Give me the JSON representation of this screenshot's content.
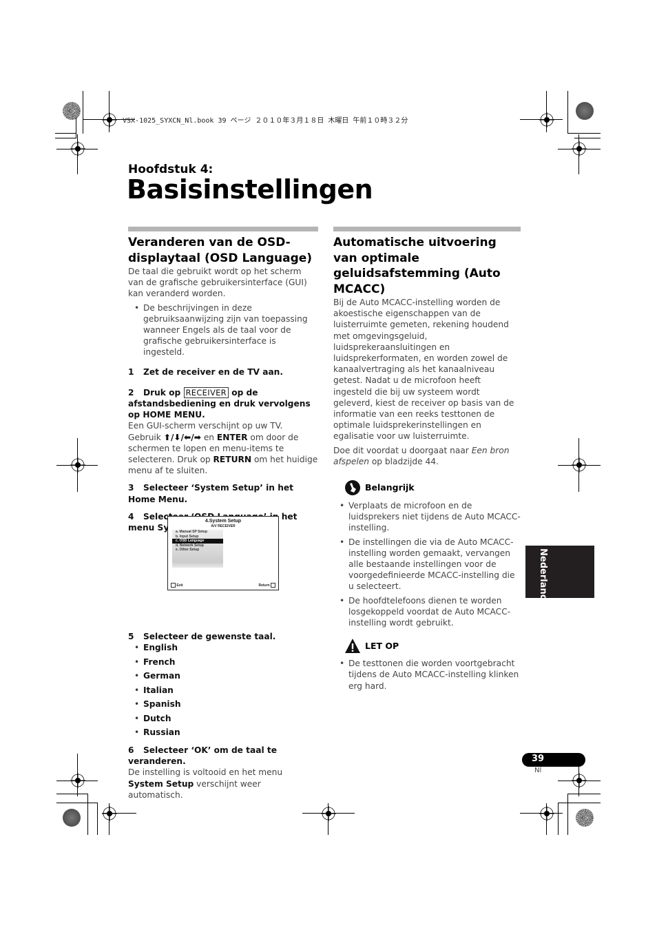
{
  "print_header": "VSX-1025_SYXCN_Nl.book  39 ページ  ２０１０年３月１８日  木曜日  午前１０時３２分",
  "chapter": {
    "label": "Hoofdstuk 4:",
    "title": "Basisinstellingen"
  },
  "left": {
    "heading": "Veranderen van de OSD-displaytaal (OSD Language)",
    "intro": "De taal die gebruikt wordt op het scherm van de grafische gebruikersinterface (GUI) kan veranderd worden.",
    "bullets": [
      "De beschrijvingen in deze gebruiksaanwijzing zijn van toepassing wanneer Engels als de taal voor de grafische gebruikersinterface is ingesteld."
    ],
    "steps": {
      "s1": {
        "num": "1",
        "text": "Zet de receiver en de TV aan."
      },
      "s2": {
        "num": "2",
        "pre": "Druk op",
        "key": "RECEIVER",
        "post": "op de afstandsbediening en druk vervolgens op HOME MENU.",
        "body_1": "Een GUI-scherm verschijnt op uw TV. Gebruik",
        "arrows": "⬆/⬇/⬅/➡",
        "body_2": "en",
        "enter": "ENTER",
        "body_3": "om door de schermen te lopen en menu-items te selecteren. Druk op",
        "return": "RETURN",
        "body_4": "om het huidige menu af te sluiten."
      },
      "s3": {
        "num": "3",
        "text": "Selecteer ‘System Setup’ in het Home Menu."
      },
      "s4": {
        "num": "4",
        "text": "Selecteer ‘OSD Language’ in het menu System Setup."
      },
      "s5": {
        "num": "5",
        "text": "Selecteer de gewenste taal."
      },
      "s6": {
        "num": "6",
        "text": "Selecteer ‘OK’ om de taal te veranderen.",
        "body_1": "De instelling is voltooid en het menu",
        "body_bold": "System Setup",
        "body_2": "verschijnt weer automatisch."
      }
    },
    "languages": [
      "English",
      "French",
      "German",
      "Italian",
      "Spanish",
      "Dutch",
      "Russian"
    ],
    "osd_screen": {
      "title": "4.System Setup",
      "subtitle": "A/V RECEIVER",
      "items": [
        "a. Manual SP Setup",
        "b. Input Setup",
        "c. OSD Language",
        "d. Network Setup",
        "e. Other Setup"
      ],
      "selected": "c. OSD Language",
      "exit_label": "Exit",
      "return_label": "Return"
    }
  },
  "right": {
    "heading": "Automatische uitvoering van optimale geluidsafstemming (Auto MCACC)",
    "intro": "Bij de Auto MCACC-instelling worden de akoestische eigenschappen van de luisterruimte gemeten, rekening houdend met omgevingsgeluid, luidsprekeraansluitingen en luidsprekerformaten, en worden zowel de kanaalvertraging als het kanaalniveau getest. Nadat u de microfoon heeft ingesteld die bij uw systeem wordt geleverd, kiest de receiver op basis van de informatie van een reeks testtonen de optimale luidsprekerinstellingen en egalisatie voor uw luisterruimte.",
    "ref_pre": "Doe dit voordat u doorgaat naar",
    "ref_italic": "Een bron afspelen",
    "ref_post": "op bladzijde 44.",
    "important": {
      "title": "Belangrijk",
      "icon": "important-hand-icon",
      "bullets": [
        "Verplaats de microfoon en de luidsprekers niet tijdens de Auto MCACC-instelling.",
        "De instellingen die via de Auto MCACC-instelling worden gemaakt, vervangen alle bestaande instellingen voor de voorgedefinieerde MCACC-instelling die u selecteert.",
        "De hoofdtelefoons dienen te worden losgekoppeld voordat de Auto MCACC-instelling wordt gebruikt."
      ]
    },
    "caution": {
      "title": "LET OP",
      "icon": "warning-triangle-icon",
      "bullets": [
        "De testtonen die worden voortgebracht tijdens de Auto MCACC-instelling klinken erg hard."
      ]
    }
  },
  "side_tab": "Nederlands",
  "page": {
    "number": "39",
    "lang": "Nl"
  }
}
